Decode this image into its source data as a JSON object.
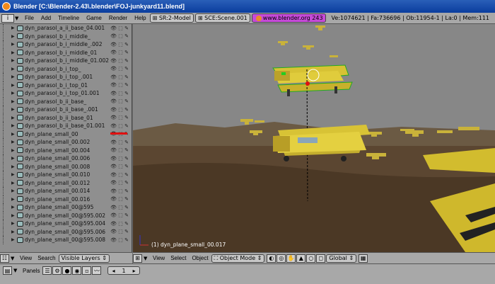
{
  "window": {
    "title": "Blender [C:\\Blender-2.43\\.blender\\FOJ-junkyard11.blend]"
  },
  "menu": {
    "items": [
      "File",
      "Add",
      "Timeline",
      "Game",
      "Render",
      "Help"
    ],
    "screen": "SR:2-Model",
    "scene": "SCE:Scene.001",
    "url": "www.blender.org 243",
    "stats": "Ve:1074621 | Fa:736696 | Ob:11954-1 | La:0 | Mem:111"
  },
  "outliner": {
    "items": [
      {
        "label": "dyn_parasol_a_ii_base_04.001",
        "selected": false
      },
      {
        "label": "dyn_parasol_b_i_middle_",
        "selected": false
      },
      {
        "label": "dyn_parasol_b_i_middle_.002",
        "selected": false
      },
      {
        "label": "dyn_parasol_b_i_middle_01",
        "selected": false
      },
      {
        "label": "dyn_parasol_b_i_middle_01.002",
        "selected": false
      },
      {
        "label": "dyn_parasol_b_i_top_",
        "selected": false
      },
      {
        "label": "dyn_parasol_b_i_top_.001",
        "selected": false
      },
      {
        "label": "dyn_parasol_b_i_top_01",
        "selected": false
      },
      {
        "label": "dyn_parasol_b_i_top_01.001",
        "selected": false
      },
      {
        "label": "dyn_parasol_b_ii_base_",
        "selected": false
      },
      {
        "label": "dyn_parasol_b_ii_base_.001",
        "selected": false
      },
      {
        "label": "dyn_parasol_b_ii_base_01",
        "selected": false
      },
      {
        "label": "dyn_parasol_b_ii_base_01.001",
        "selected": false
      },
      {
        "label": "dyn_plane_small_00",
        "selected": false
      },
      {
        "label": "dyn_plane_small_00.002",
        "selected": false
      },
      {
        "label": "dyn_plane_small_00.004",
        "selected": false
      },
      {
        "label": "dyn_plane_small_00.006",
        "selected": false
      },
      {
        "label": "dyn_plane_small_00.008",
        "selected": false
      },
      {
        "label": "dyn_plane_small_00.010",
        "selected": false
      },
      {
        "label": "dyn_plane_small_00.012",
        "selected": false
      },
      {
        "label": "dyn_plane_small_00.014",
        "selected": false
      },
      {
        "label": "dyn_plane_small_00.016",
        "selected": false
      },
      {
        "label": "dyn_plane_small_00@595",
        "selected": false
      },
      {
        "label": "dyn_plane_small_00@595.002",
        "selected": false
      },
      {
        "label": "dyn_plane_small_00@595.004",
        "selected": false
      },
      {
        "label": "dyn_plane_small_00@595.006",
        "selected": false
      },
      {
        "label": "dyn_plane_small_00@595.008",
        "selected": false
      }
    ]
  },
  "viewport": {
    "object_label": "(1) dyn_plane_small_00.017"
  },
  "outliner_header": {
    "view": "View",
    "search": "Search",
    "dropdown": "Visible Layers"
  },
  "viewport_header": {
    "view": "View",
    "select": "Select",
    "object": "Object",
    "mode": "Object Mode",
    "orientation": "Global"
  },
  "buttons_header": {
    "panels": "Panels",
    "page": "1"
  }
}
